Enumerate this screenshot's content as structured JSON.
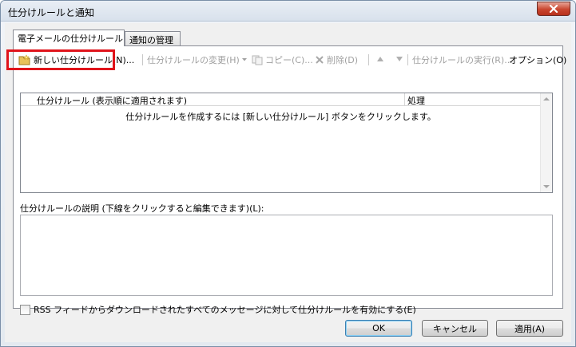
{
  "window": {
    "title": "仕分けルールと通知"
  },
  "tabs": [
    {
      "label": "電子メールの仕分けルール",
      "active": true
    },
    {
      "label": "通知の管理",
      "active": false
    }
  ],
  "toolbar": {
    "new_rule": "新しい仕分けルール(N)...",
    "change_rule": "仕分けルールの変更(H)",
    "copy": "コピー(C)...",
    "delete": "削除(D)",
    "run_rules": "仕分けルールの実行(R)...",
    "options": "オプション(O)"
  },
  "rules_list": {
    "columns": [
      "仕分けルール (表示順に適用されます)",
      "処理"
    ],
    "empty_message": "仕分けルールを作成するには [新しい仕分けルール] ボタンをクリックします。"
  },
  "description": {
    "label": "仕分けルールの説明 (下線をクリックすると編集できます)(L):"
  },
  "rss_option": {
    "label": "RSS フィードからダウンロードされたすべてのメッセージに対して仕分けルールを有効にする(E)",
    "checked": false
  },
  "buttons": {
    "ok": "OK",
    "cancel": "キャンセル",
    "apply": "適用(A)"
  },
  "colors": {
    "highlight": "#e0141b",
    "close_button": "#c9462f"
  }
}
